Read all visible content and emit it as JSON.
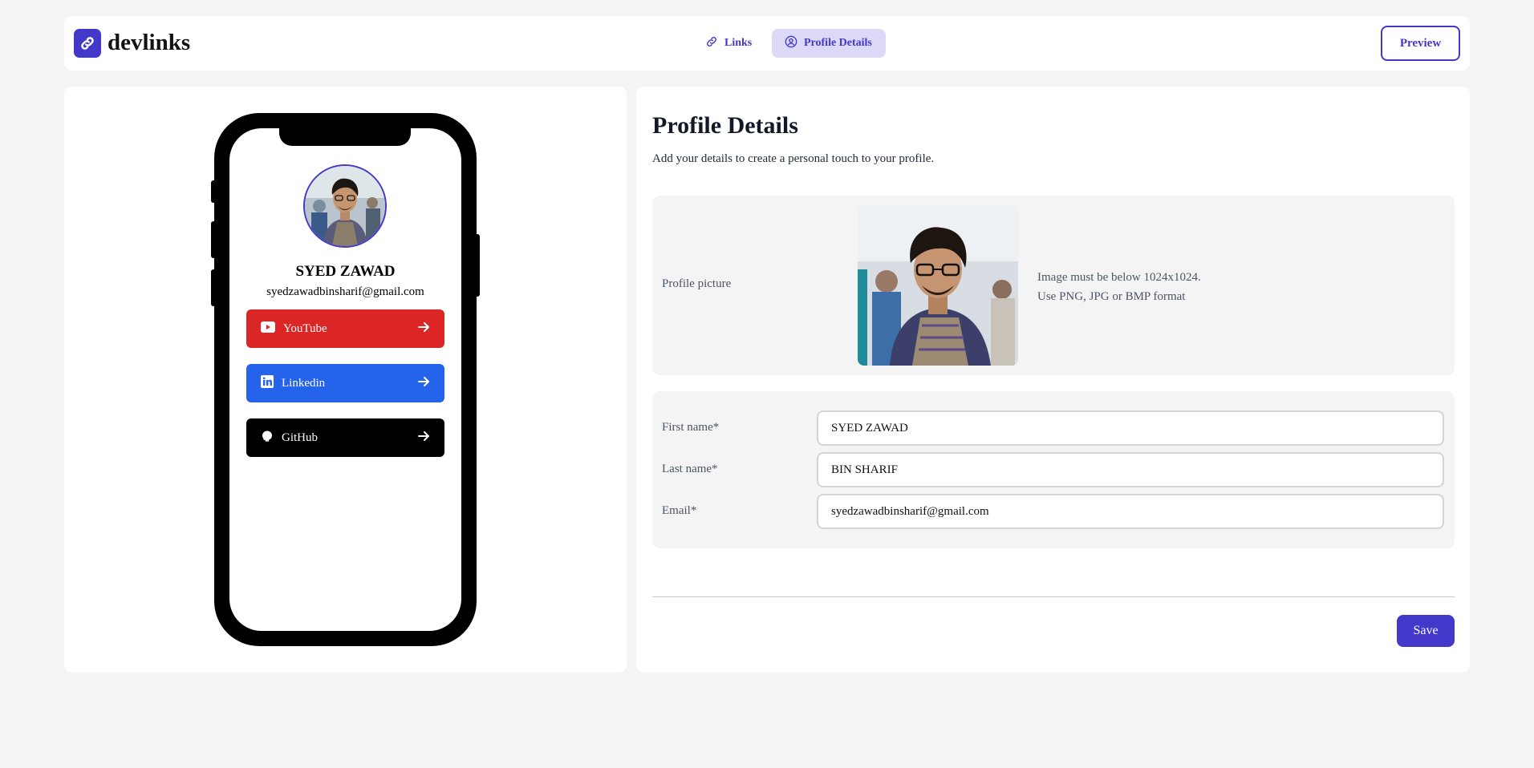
{
  "app": {
    "logo_text": "devlinks",
    "brand_color": "#4338ca"
  },
  "nav": {
    "links_label": "Links",
    "profile_label": "Profile Details",
    "preview_label": "Preview"
  },
  "preview": {
    "name": "SYED ZAWAD",
    "email": "syedzawadbinsharif@gmail.com",
    "links": [
      {
        "platform": "YouTube",
        "color": "#dc2626",
        "icon": "youtube-icon"
      },
      {
        "platform": "Linkedin",
        "color": "#2563eb",
        "icon": "linkedin-icon"
      },
      {
        "platform": "GitHub",
        "color": "#000000",
        "icon": "github-icon"
      }
    ]
  },
  "profile": {
    "title": "Profile Details",
    "subtitle": "Add your details to create a personal touch to your profile.",
    "picture_label": "Profile picture",
    "picture_note_1": "Image must be below 1024x1024.",
    "picture_note_2": "Use PNG, JPG or BMP format",
    "first_name_label": "First name*",
    "first_name_value": "SYED ZAWAD",
    "last_name_label": "Last name*",
    "last_name_value": "BIN SHARIF",
    "email_label": "Email*",
    "email_value": "syedzawadbinsharif@gmail.com",
    "save_label": "Save"
  }
}
